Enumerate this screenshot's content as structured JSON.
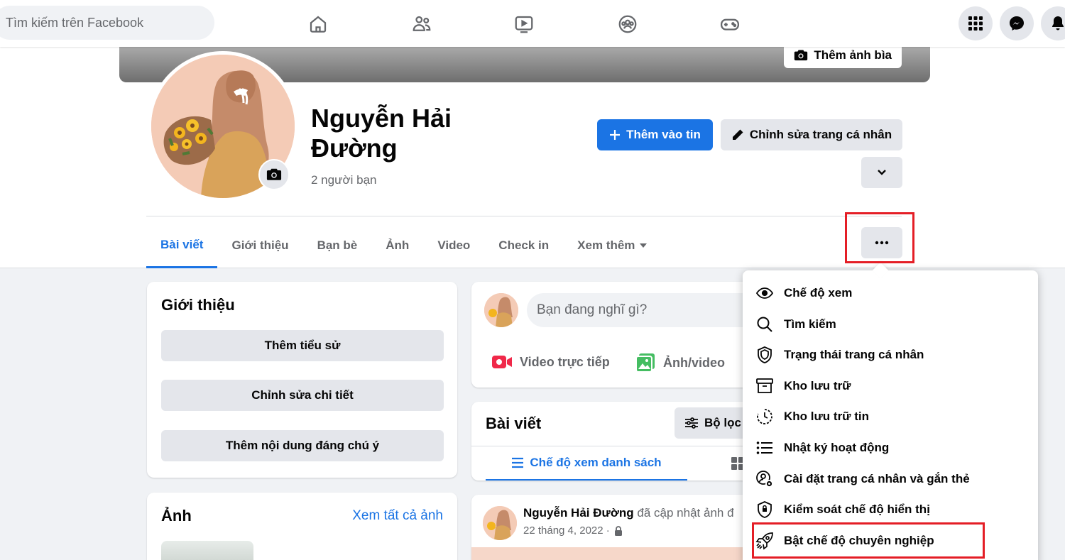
{
  "topbar": {
    "search_placeholder": "Tìm kiếm trên Facebook",
    "nav_icons": [
      "home-icon",
      "friends-icon",
      "watch-icon",
      "groups-icon",
      "gaming-icon"
    ],
    "right_icons": [
      "menu-grid-icon",
      "messenger-icon",
      "bell-icon"
    ]
  },
  "profile": {
    "cover_button": "Thêm ảnh bìa",
    "name": "Nguyễn Hải Đường",
    "friends_count": "2 người bạn",
    "add_story": "Thêm vào tin",
    "edit_profile": "Chỉnh sửa trang cá nhân"
  },
  "tabs": [
    {
      "label": "Bài viết"
    },
    {
      "label": "Giới thiệu"
    },
    {
      "label": "Bạn bè"
    },
    {
      "label": "Ảnh"
    },
    {
      "label": "Video"
    },
    {
      "label": "Check in"
    },
    {
      "label": "Xem thêm"
    }
  ],
  "intro": {
    "title": "Giới thiệu",
    "buttons": [
      "Thêm tiểu sử",
      "Chỉnh sửa chi tiết",
      "Thêm nội dung đáng chú ý"
    ]
  },
  "photos": {
    "title": "Ảnh",
    "see_all": "Xem tất cả ảnh"
  },
  "composer": {
    "placeholder": "Bạn đang nghĩ gì?",
    "live_video": "Video trực tiếp",
    "photo_video": "Ảnh/video"
  },
  "posts": {
    "title": "Bài viết",
    "filter": "Bộ lọc",
    "list_view": "Chế độ xem danh sách"
  },
  "post": {
    "author": "Nguyễn Hải Đường",
    "action": "đã cập nhật ảnh đ",
    "date": "22 tháng 4, 2022 ·"
  },
  "menu": {
    "items": [
      {
        "label": "Chế độ xem",
        "icon": "eye-icon"
      },
      {
        "label": "Tìm kiếm",
        "icon": "search-icon"
      },
      {
        "label": "Trạng thái trang cá nhân",
        "icon": "shield-icon"
      },
      {
        "label": "Kho lưu trữ",
        "icon": "archive-icon"
      },
      {
        "label": "Kho lưu trữ tin",
        "icon": "story-archive-icon"
      },
      {
        "label": "Nhật ký hoạt động",
        "icon": "activity-log-icon"
      },
      {
        "label": "Cài đặt trang cá nhân và gắn thẻ",
        "icon": "profile-settings-icon"
      },
      {
        "label": "Kiểm soát chế độ hiển thị",
        "icon": "lock-shield-icon"
      },
      {
        "label": "Bật chế độ chuyên nghiệp",
        "icon": "rocket-icon"
      }
    ]
  },
  "colors": {
    "accent": "#1b74e4",
    "highlight": "#e41e26",
    "button_grey": "#e4e6eb",
    "background": "#f0f2f5"
  }
}
